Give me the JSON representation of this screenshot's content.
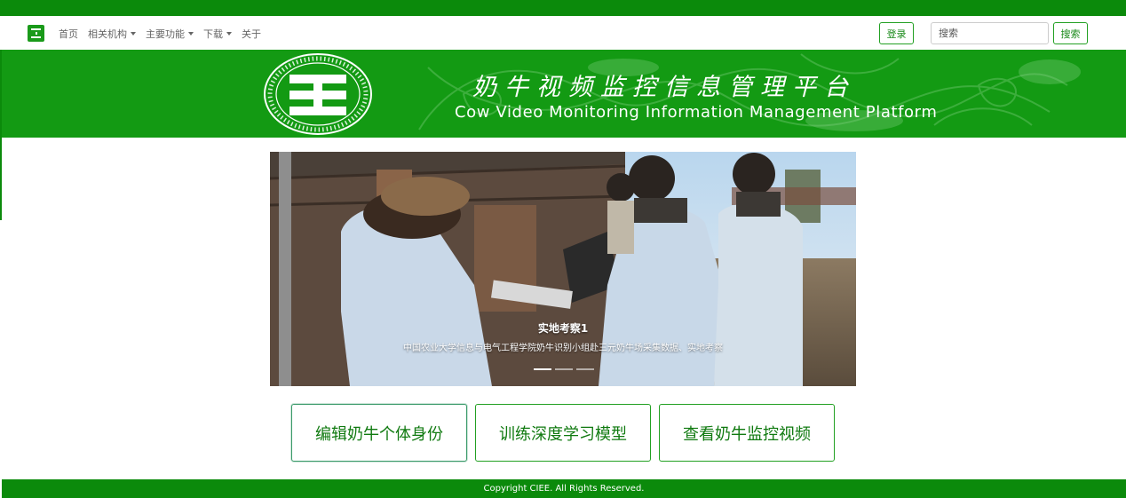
{
  "colors": {
    "brand_green": "#0b8a0b",
    "banner_green": "#139a13",
    "button_text": "#107a10",
    "white": "#ffffff"
  },
  "nav": {
    "logo_icon": "platform-logo-icon",
    "items": [
      {
        "label": "首页",
        "has_dropdown": false
      },
      {
        "label": "相关机构",
        "has_dropdown": true
      },
      {
        "label": "主要功能",
        "has_dropdown": true
      },
      {
        "label": "下载",
        "has_dropdown": true
      },
      {
        "label": "关于",
        "has_dropdown": false
      }
    ],
    "login_label": "登录",
    "search_placeholder": "搜索",
    "search_button_label": "搜索"
  },
  "banner": {
    "title": "奶牛视频监控信息管理平台",
    "subtitle": "Cow Video Monitoring Information Management Platform",
    "seal_icon": "platform-seal-icon"
  },
  "carousel": {
    "slide_title": "实地考察1",
    "slide_text": "中国农业大学信息与电气工程学院奶牛识别小组赴三元奶牛场采集数据、实地考察",
    "indicator_count": 3,
    "active_index": 0
  },
  "actions": [
    {
      "label": "编辑奶牛个体身份"
    },
    {
      "label": "训练深度学习模型"
    },
    {
      "label": "查看奶牛监控视频"
    }
  ],
  "footer": {
    "copyright": "Copyright CIEE. All Rights Reserved."
  }
}
